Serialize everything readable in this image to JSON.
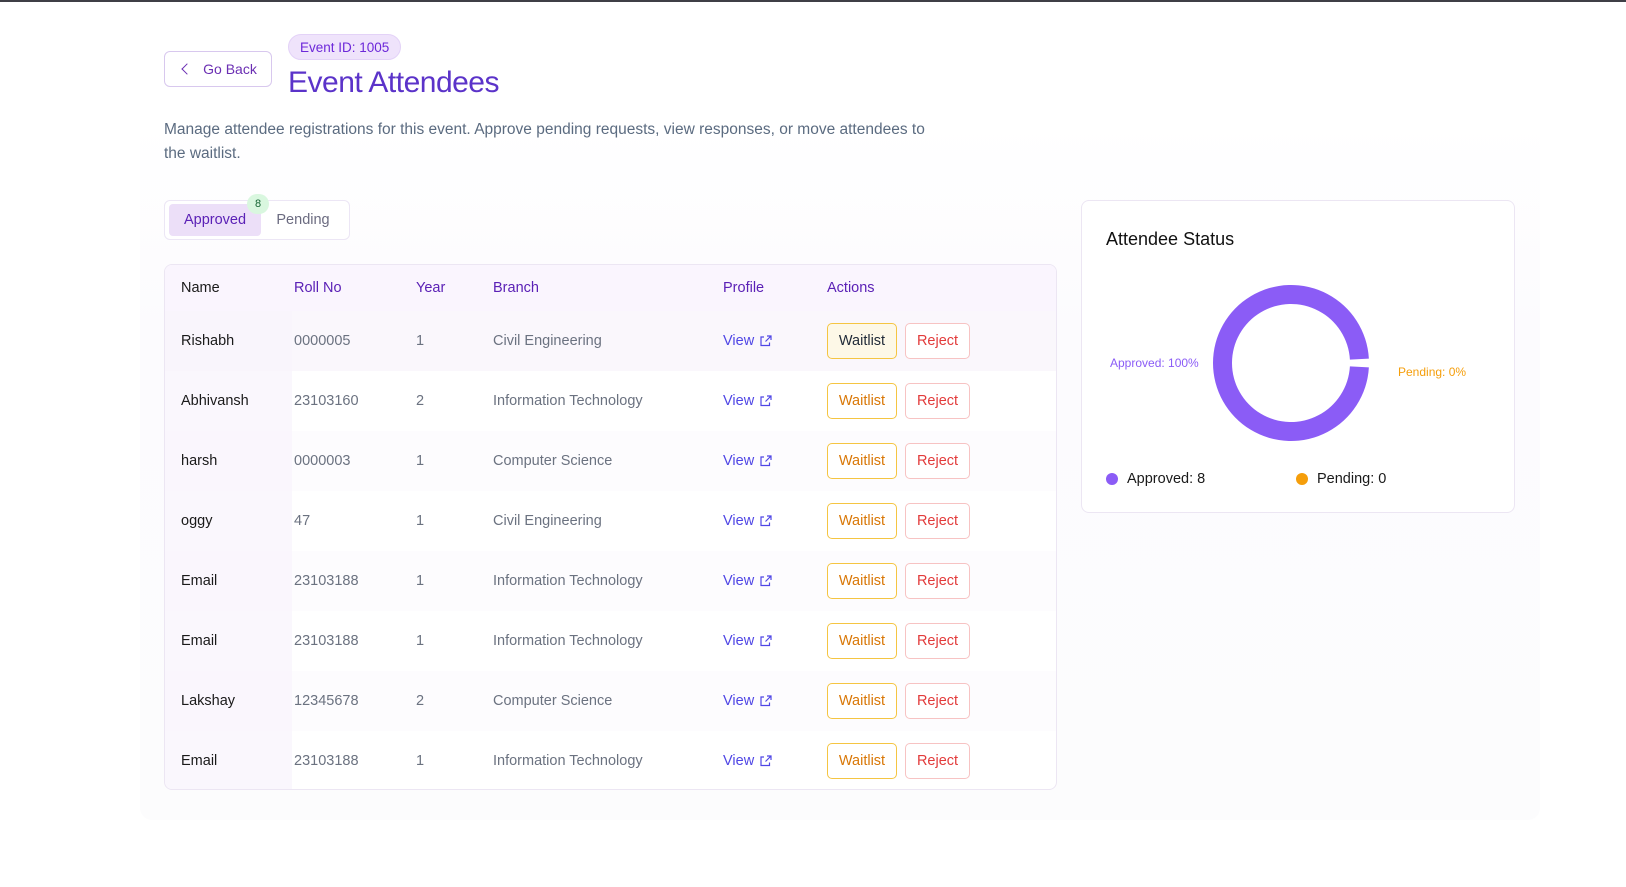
{
  "header": {
    "go_back_label": "Go Back",
    "event_id": "Event ID: 1005",
    "title": "Event Attendees",
    "description": "Manage attendee registrations for this event. Approve pending requests, view responses, or move attendees to the waitlist."
  },
  "tabs": {
    "approved_label": "Approved",
    "approved_count": "8",
    "pending_label": "Pending"
  },
  "table": {
    "headers": {
      "name": "Name",
      "roll": "Roll No",
      "year": "Year",
      "branch": "Branch",
      "profile": "Profile",
      "actions": "Actions"
    },
    "view_label": "View",
    "waitlist_label": "Waitlist",
    "reject_label": "Reject",
    "rows": [
      {
        "name": "Rishabh",
        "roll": "0000005",
        "year": "1",
        "branch": "Civil Engineering"
      },
      {
        "name": "Abhivansh",
        "roll": "23103160",
        "year": "2",
        "branch": "Information Technology"
      },
      {
        "name": "harsh",
        "roll": "0000003",
        "year": "1",
        "branch": "Computer Science"
      },
      {
        "name": "oggy",
        "roll": "47",
        "year": "1",
        "branch": "Civil Engineering"
      },
      {
        "name": "Email",
        "roll": "23103188",
        "year": "1",
        "branch": "Information Technology"
      },
      {
        "name": "Email",
        "roll": "23103188",
        "year": "1",
        "branch": "Information Technology"
      },
      {
        "name": "Lakshay",
        "roll": "12345678",
        "year": "2",
        "branch": "Computer Science"
      },
      {
        "name": "Email",
        "roll": "23103188",
        "year": "1",
        "branch": "Information Technology"
      }
    ]
  },
  "status": {
    "title": "Attendee Status",
    "approved_label": "Approved: 100%",
    "pending_label": "Pending: 0%",
    "legend_approved": "Approved: 8",
    "legend_pending": "Pending: 0",
    "approved_color": "#8b5cf6",
    "pending_color": "#f59e0b"
  },
  "chart_data": {
    "type": "pie",
    "title": "Attendee Status",
    "categories": [
      "Approved",
      "Pending"
    ],
    "values": [
      8,
      0
    ],
    "legend": "bottom"
  }
}
